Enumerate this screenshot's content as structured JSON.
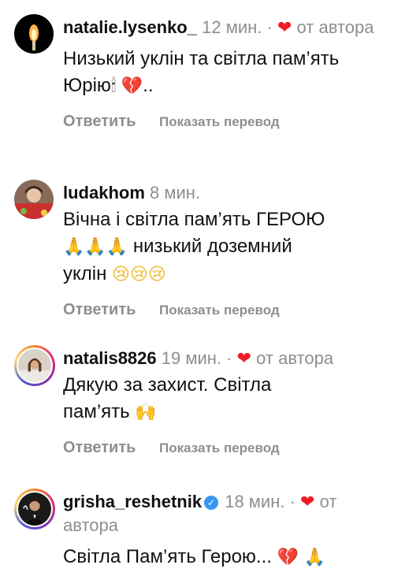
{
  "comments": [
    {
      "username": "natalie.lysenko_",
      "time": "12 мин.",
      "separator": "·",
      "heart": "❤",
      "author_like": "от автора",
      "line1": "Низький уклін та світла пам’ять",
      "line2_text": "Юрію",
      "line2_emoji_candle": "🕯",
      "line2_emoji_broken": "💔",
      "line2_suffix": "..",
      "reply_label": "Ответить",
      "translate_label": "Показать перевод"
    },
    {
      "username": "ludakhom",
      "time": "8 мин.",
      "line1": "Вічна і світла пам’ять ГЕРОЮ",
      "line2_emoji": "🙏🙏🙏",
      "line2_text": "низький доземний",
      "line3_text": "уклін",
      "line3_emoji": "😢😢😢",
      "reply_label": "Ответить",
      "translate_label": "Показать перевод"
    },
    {
      "username": "natalis8826",
      "time": "19 мин.",
      "separator": "·",
      "heart": "❤",
      "author_like": "от автора",
      "line1": "Дякую за захист. Світла",
      "line2_text": "пам’ять",
      "line2_emoji": "🙌",
      "reply_label": "Ответить",
      "translate_label": "Показать перевод"
    },
    {
      "username": "grisha_reshetnik",
      "verified": "✓",
      "time": "18 мин.",
      "separator": "·",
      "heart": "❤",
      "author_like_1": "от",
      "author_like_2": "автора",
      "line1": "Світла Пам’ять Герою...",
      "line1_emoji_broken": "💔",
      "line1_emoji_pray": "🙏"
    }
  ]
}
